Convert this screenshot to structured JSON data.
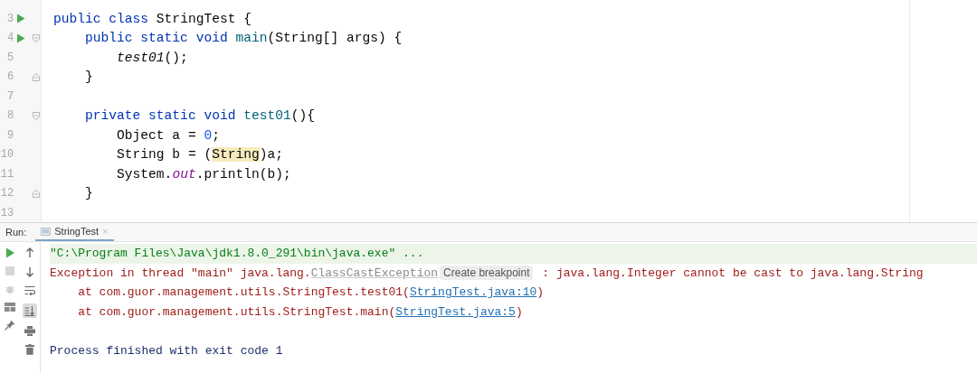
{
  "editor": {
    "lines": [
      {
        "number": "3",
        "run": true,
        "fold_start": false,
        "fold_end": false,
        "tokens": [
          {
            "text": "public class ",
            "kind": "kw"
          },
          {
            "text": "StringTest {",
            "kind": "plain"
          }
        ]
      },
      {
        "number": "4",
        "run": true,
        "fold_start": true,
        "fold_end": false,
        "tokens": [
          {
            "text": "    public static void ",
            "kind": "kw"
          },
          {
            "text": "main",
            "kind": "decl"
          },
          {
            "text": "(String[] args) {",
            "kind": "plain"
          }
        ]
      },
      {
        "number": "5",
        "run": false,
        "fold_start": false,
        "fold_end": false,
        "tokens": [
          {
            "text": "        test01",
            "kind": "static-call"
          },
          {
            "text": "();",
            "kind": "plain"
          }
        ]
      },
      {
        "number": "6",
        "run": false,
        "fold_start": false,
        "fold_end": true,
        "tokens": [
          {
            "text": "    }",
            "kind": "plain"
          }
        ]
      },
      {
        "number": "7",
        "run": false,
        "fold_start": false,
        "fold_end": false
      },
      {
        "number": "8",
        "run": false,
        "fold_start": true,
        "fold_end": false,
        "tokens": [
          {
            "text": "    private static void ",
            "kind": "kw"
          },
          {
            "text": "test01",
            "kind": "decl"
          },
          {
            "text": "(){",
            "kind": "plain"
          }
        ]
      },
      {
        "number": "9",
        "run": false,
        "fold_start": false,
        "fold_end": false,
        "tokens": [
          {
            "text": "        Object a = ",
            "kind": "plain"
          },
          {
            "text": "0",
            "kind": "num"
          },
          {
            "text": ";",
            "kind": "plain"
          }
        ]
      },
      {
        "number": "10",
        "run": false,
        "fold_start": false,
        "fold_end": false,
        "tokens": [
          {
            "text": "        String b = (",
            "kind": "plain"
          },
          {
            "text": "String",
            "kind": "warn"
          },
          {
            "text": ")a;",
            "kind": "plain"
          }
        ]
      },
      {
        "number": "11",
        "run": false,
        "fold_start": false,
        "fold_end": false,
        "tokens": [
          {
            "text": "        System.",
            "kind": "plain"
          },
          {
            "text": "out",
            "kind": "static-field"
          },
          {
            "text": ".println(b);",
            "kind": "plain"
          }
        ]
      },
      {
        "number": "12",
        "run": false,
        "fold_start": false,
        "fold_end": true,
        "tokens": [
          {
            "text": "    }",
            "kind": "plain"
          }
        ]
      },
      {
        "number": "13",
        "run": false,
        "fold_start": false,
        "fold_end": false
      }
    ]
  },
  "run_panel": {
    "label": "Run:",
    "tabs": [
      {
        "label": "StringTest",
        "close": "×",
        "selected": true
      }
    ],
    "autoscroll": true,
    "console": [
      {
        "kind": "command",
        "segments": [
          {
            "text": "\"C:\\Program Files\\Java\\jdk1.8.0_291\\bin\\java.exe\" ...",
            "kind": "plain"
          }
        ]
      },
      {
        "kind": "error",
        "segments": [
          {
            "text": "Exception in thread \"main\" java.lang.",
            "kind": "plain"
          },
          {
            "text": "ClassCastException",
            "kind": "class-link"
          },
          {
            "text": "Create breakpoint",
            "kind": "hint"
          },
          {
            "text": " : java.lang.Integer cannot be cast to java.lang.String",
            "kind": "plain"
          }
        ]
      },
      {
        "kind": "error",
        "segments": [
          {
            "text": "    at com.guor.management.utils.StringTest.test01(",
            "kind": "plain"
          },
          {
            "text": "StringTest.java:10",
            "kind": "link"
          },
          {
            "text": ")",
            "kind": "plain"
          }
        ]
      },
      {
        "kind": "error",
        "segments": [
          {
            "text": "    at com.guor.management.utils.StringTest.main(",
            "kind": "plain"
          },
          {
            "text": "StringTest.java:5",
            "kind": "link"
          },
          {
            "text": ")",
            "kind": "plain"
          }
        ]
      },
      {
        "kind": "blank"
      },
      {
        "kind": "info",
        "segments": [
          {
            "text": "Process finished with exit code 1",
            "kind": "plain"
          }
        ]
      }
    ]
  }
}
